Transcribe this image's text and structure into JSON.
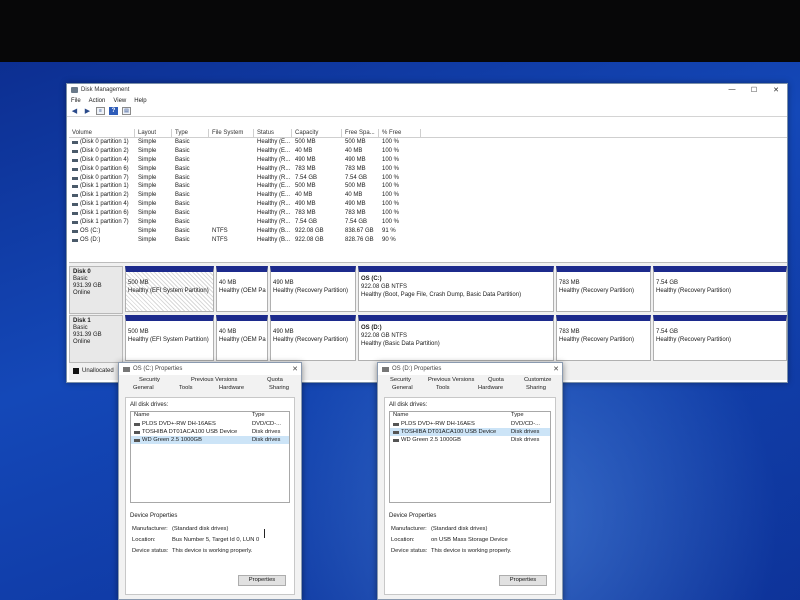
{
  "window": {
    "title": "Disk Management",
    "controls": [
      "—",
      "☐",
      "✕"
    ],
    "menu": [
      "File",
      "Action",
      "View",
      "Help"
    ],
    "toolbar_icons": [
      "back-arrow-icon",
      "forward-arrow-icon",
      "list-view-icon",
      "help-icon",
      "disk-view-icon"
    ],
    "help_glyph": "?"
  },
  "volume_list": {
    "columns": [
      "Volume",
      "Layout",
      "Type",
      "File System",
      "Status",
      "Capacity",
      "Free Spa...",
      "% Free"
    ],
    "rows": [
      [
        "(Disk 0 partition 1)",
        "Simple",
        "Basic",
        "",
        "Healthy (E...",
        "500 MB",
        "500 MB",
        "100 %"
      ],
      [
        "(Disk 0 partition 2)",
        "Simple",
        "Basic",
        "",
        "Healthy (E...",
        "40 MB",
        "40 MB",
        "100 %"
      ],
      [
        "(Disk 0 partition 4)",
        "Simple",
        "Basic",
        "",
        "Healthy (R...",
        "490 MB",
        "490 MB",
        "100 %"
      ],
      [
        "(Disk 0 partition 6)",
        "Simple",
        "Basic",
        "",
        "Healthy (R...",
        "783 MB",
        "783 MB",
        "100 %"
      ],
      [
        "(Disk 0 partition 7)",
        "Simple",
        "Basic",
        "",
        "Healthy (R...",
        "7.54 GB",
        "7.54 GB",
        "100 %"
      ],
      [
        "(Disk 1 partition 1)",
        "Simple",
        "Basic",
        "",
        "Healthy (E...",
        "500 MB",
        "500 MB",
        "100 %"
      ],
      [
        "(Disk 1 partition 2)",
        "Simple",
        "Basic",
        "",
        "Healthy (E...",
        "40 MB",
        "40 MB",
        "100 %"
      ],
      [
        "(Disk 1 partition 4)",
        "Simple",
        "Basic",
        "",
        "Healthy (R...",
        "490 MB",
        "490 MB",
        "100 %"
      ],
      [
        "(Disk 1 partition 6)",
        "Simple",
        "Basic",
        "",
        "Healthy (R...",
        "783 MB",
        "783 MB",
        "100 %"
      ],
      [
        "(Disk 1 partition 7)",
        "Simple",
        "Basic",
        "",
        "Healthy (R...",
        "7.54 GB",
        "7.54 GB",
        "100 %"
      ],
      [
        "OS (C:)",
        "Simple",
        "Basic",
        "NTFS",
        "Healthy (B...",
        "922.08 GB",
        "838.67 GB",
        "91 %"
      ],
      [
        "OS (D:)",
        "Simple",
        "Basic",
        "NTFS",
        "Healthy (B...",
        "922.08 GB",
        "828.76 GB",
        "90 %"
      ]
    ]
  },
  "disks": [
    {
      "name": "Disk 0",
      "type": "Basic",
      "size": "931.39 GB",
      "status": "Online",
      "partitions": [
        {
          "title": "",
          "size": "500 MB",
          "status": "Healthy (EFI System Partition)"
        },
        {
          "title": "",
          "size": "40 MB",
          "status": "Healthy (OEM Pa"
        },
        {
          "title": "",
          "size": "490 MB",
          "status": "Healthy (Recovery Partition)"
        },
        {
          "title": "OS (C:)",
          "size": "922.08 GB NTFS",
          "status": "Healthy (Boot, Page File, Crash Dump, Basic Data Partition)"
        },
        {
          "title": "",
          "size": "783 MB",
          "status": "Healthy (Recovery Partition)"
        },
        {
          "title": "",
          "size": "7.54 GB",
          "status": "Healthy (Recovery Partition)"
        }
      ]
    },
    {
      "name": "Disk 1",
      "type": "Basic",
      "size": "931.39 GB",
      "status": "Online",
      "partitions": [
        {
          "title": "",
          "size": "500 MB",
          "status": "Healthy (EFI System Partition)"
        },
        {
          "title": "",
          "size": "40 MB",
          "status": "Healthy (OEM Pa"
        },
        {
          "title": "",
          "size": "490 MB",
          "status": "Healthy (Recovery Partition)"
        },
        {
          "title": "OS (D:)",
          "size": "922.08 GB NTFS",
          "status": "Healthy (Basic Data Partition)"
        },
        {
          "title": "",
          "size": "783 MB",
          "status": "Healthy (Recovery Partition)"
        },
        {
          "title": "",
          "size": "7.54 GB",
          "status": "Healthy (Recovery Partition)"
        }
      ]
    }
  ],
  "legend": {
    "unallocated": "Unallocated"
  },
  "dialog_c": {
    "title": "OS (C:) Properties",
    "close": "✕",
    "tabs_row1": [
      "Security",
      "Previous Versions",
      "Quota"
    ],
    "tabs_row2": [
      "General",
      "Tools",
      "Hardware",
      "Sharing"
    ],
    "section_label": "All disk drives:",
    "list_headers": [
      "Name",
      "Type"
    ],
    "drives": [
      {
        "name": "PLDS DVD+-RW DH-16AES",
        "type": "DVD/CD-..."
      },
      {
        "name": "TOSHIBA DT01ACA100 USB Device",
        "type": "Disk drives"
      },
      {
        "name": "WD Green 2.5 1000GB",
        "type": "Disk drives"
      }
    ],
    "device_props_title": "Device Properties",
    "manufacturer_label": "Manufacturer:",
    "manufacturer": "(Standard disk drives)",
    "location_label": "Location:",
    "location": "Bus Number 5, Target Id 0, LUN 0",
    "status_label": "Device status:",
    "status": "This device is working properly.",
    "button": "Properties"
  },
  "dialog_d": {
    "title": "OS (D:) Properties",
    "close": "✕",
    "tabs_row1": [
      "Security",
      "Previous Versions",
      "Quota",
      "Customize"
    ],
    "tabs_row2": [
      "General",
      "Tools",
      "Hardware",
      "Sharing"
    ],
    "section_label": "All disk drives:",
    "list_headers": [
      "Name",
      "Type"
    ],
    "drives": [
      {
        "name": "PLDS DVD+-RW DH-16AES",
        "type": "DVD/CD-..."
      },
      {
        "name": "TOSHIBA DT01ACA100 USB Device",
        "type": "Disk drives"
      },
      {
        "name": "WD Green 2.5 1000GB",
        "type": "Disk drives"
      }
    ],
    "device_props_title": "Device Properties",
    "manufacturer_label": "Manufacturer:",
    "manufacturer": "(Standard disk drives)",
    "location_label": "Location:",
    "location": "on USB Mass Storage Device",
    "status_label": "Device status:",
    "status": "This device is working properly.",
    "button": "Properties"
  }
}
